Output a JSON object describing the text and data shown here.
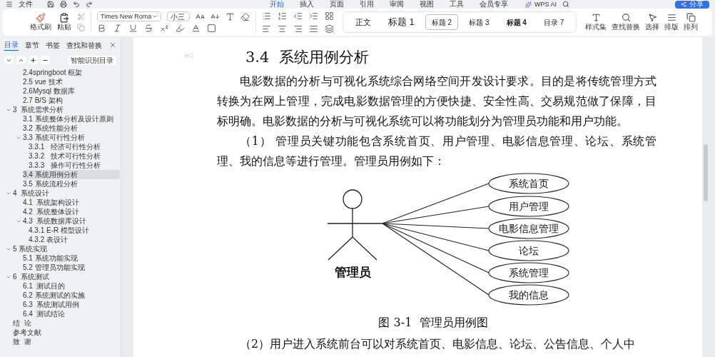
{
  "title_bar": {
    "file_menu": "文件",
    "tabs": [
      {
        "label": "开始",
        "selected": true
      },
      {
        "label": "插入",
        "selected": false
      },
      {
        "label": "页面",
        "selected": false
      },
      {
        "label": "引用",
        "selected": false
      },
      {
        "label": "审阅",
        "selected": false
      },
      {
        "label": "视图",
        "selected": false
      },
      {
        "label": "工具",
        "selected": false
      },
      {
        "label": "会员专享",
        "selected": false
      }
    ],
    "ai_button": "WPS AI",
    "share_button": "分享"
  },
  "ribbon": {
    "format_painter": "格式刷",
    "paste": "粘贴",
    "font_name": "Times New Roma",
    "font_size": "小三",
    "styles": [
      {
        "label": "正文",
        "selected": false
      },
      {
        "label": "标题 1",
        "selected": false
      },
      {
        "label": "标题 2",
        "selected": true
      },
      {
        "label": "标题 3",
        "selected": false
      },
      {
        "label": "标题 4",
        "selected": false
      },
      {
        "label": "目录 7",
        "selected": false
      }
    ],
    "tools": [
      "样式集",
      "查找替换",
      "选择",
      "排版",
      "排列"
    ]
  },
  "sidebar": {
    "tabs": [
      {
        "label": "目录",
        "selected": true
      },
      {
        "label": "章节",
        "selected": false
      },
      {
        "label": "书签",
        "selected": false
      },
      {
        "label": "查找和替换",
        "selected": false
      }
    ],
    "smart_button": "智能识别目录",
    "outline_continued": [
      {
        "label": "2.4springboot 框架",
        "selected": false
      },
      {
        "label": "2.5 vue 技术",
        "selected": false
      },
      {
        "label": "2.6Mysql 数据库",
        "selected": false
      },
      {
        "label": "2.7 B/S 架构",
        "selected": false
      }
    ],
    "outline": [
      {
        "label": "3  系统需求分析",
        "selected": false,
        "expanded": true,
        "children": [
          {
            "label": "3.1 系统整体分析及设计原则",
            "selected": false
          },
          {
            "label": "3.2 系统性能分析",
            "selected": false
          },
          {
            "label": "3.3 系统可行性分析",
            "selected": false,
            "expanded": true,
            "children": [
              {
                "label": "3.3.1   经济可行性分析",
                "selected": false
              },
              {
                "label": "3.3.2   技术可行性分析",
                "selected": false
              },
              {
                "label": "3.3.3   操作可行性分析",
                "selected": false
              }
            ]
          },
          {
            "label": "3.4 系统用例分析",
            "selected": true
          },
          {
            "label": "3.5 系统流程分析",
            "selected": false
          }
        ]
      },
      {
        "label": "4  系统设计",
        "selected": false,
        "expanded": true,
        "children": [
          {
            "label": "4.1  系统架构设计",
            "selected": false
          },
          {
            "label": "4.2  系统整体设计",
            "selected": false
          },
          {
            "label": "4.3  系统数据库设计",
            "selected": false,
            "expanded": true,
            "children": [
              {
                "label": "4.3.1 E-R 模型设计",
                "selected": false
              },
              {
                "label": "4.3.2 表设计",
                "selected": false
              }
            ]
          }
        ]
      },
      {
        "label": "5 系统实现",
        "selected": false,
        "expanded": true,
        "children": [
          {
            "label": "5.1 系统功能实现",
            "selected": false
          },
          {
            "label": "5.2 管理员功能实现",
            "selected": false
          }
        ]
      },
      {
        "label": "6  系统测试",
        "selected": false,
        "expanded": true,
        "children": [
          {
            "label": "6.1  测试目的",
            "selected": false
          },
          {
            "label": "6.2 系统测试的实施",
            "selected": false
          },
          {
            "label": "6.3  系统测试用例",
            "selected": false
          },
          {
            "label": "6.4  测试结论",
            "selected": false
          }
        ]
      },
      {
        "label": "结  论",
        "selected": false
      },
      {
        "label": "参考文献",
        "selected": false
      },
      {
        "label": "致  谢",
        "selected": false
      }
    ]
  },
  "document": {
    "heading": "3.4  系统用例分析",
    "paragraphs": [
      "电影数据的分析与可视化系统综合网络空间开发设计要求。目的是将传统管理方式转换为在网上管理，完成电影数据管理的方便快捷、安全性高、交易规范做了保障，目标明确。电影数据的分析与可视化系统可以将功能划分为管理员功能和用户功能。",
      "（1） 管理员关键功能包含系统首页、用户管理、电影信息管理、论坛、系统管理、我的信息等进行管理。管理员用例如下："
    ],
    "diagram": {
      "actor": "管理员",
      "use_cases": [
        "系统首页",
        "用户管理",
        "电影信息管理",
        "论坛",
        "系统管理",
        "我的信息"
      ]
    },
    "caption": "图 3-1  管理员用例图",
    "trailing_paragraph": "（2）用户进入系统前台可以对系统首页、电影信息、论坛、公告信息、个人中"
  }
}
